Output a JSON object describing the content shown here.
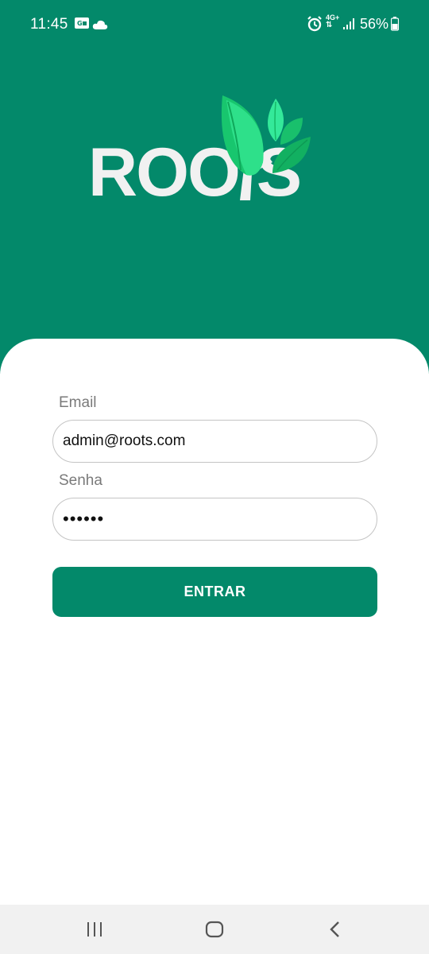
{
  "status_bar": {
    "time": "11:45",
    "battery": "56%",
    "network": "4G+",
    "icons": [
      "gallery-icon",
      "cloud-icon",
      "alarm-icon",
      "network-4g-icon",
      "signal-icon",
      "battery-icon"
    ]
  },
  "logo": {
    "text": "ROOTS",
    "visible_text": "ROO S"
  },
  "login_form": {
    "email_label": "Email",
    "email_value": "admin@roots.com",
    "password_label": "Senha",
    "password_value": "••••••",
    "submit_label": "ENTRAR"
  },
  "nav_bar": {
    "icons": [
      "recent-apps-icon",
      "home-icon",
      "back-icon"
    ]
  },
  "colors": {
    "brand": "#03896A",
    "leaf_light": "#2EE08A",
    "leaf_dark": "#13B865",
    "logo_text": "#F1F1F1",
    "nav_bg": "#F1F1F1"
  }
}
